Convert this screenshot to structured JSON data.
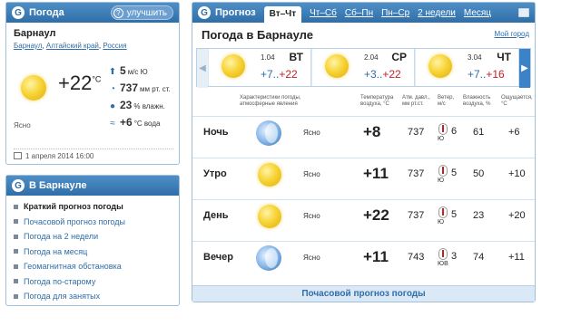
{
  "card": {
    "header_title": "Погода",
    "improve_label": "улучшить",
    "city": "Барнаул",
    "breadcrumbs": [
      "Барнаул",
      "Алтайский край",
      "Россия"
    ],
    "temp": "+22",
    "temp_unit": "°C",
    "condition": "Ясно",
    "wind_value": "5",
    "wind_unit": "м/с  Ю",
    "pressure_value": "737",
    "pressure_unit": "мм рт. ст.",
    "humidity_value": "23",
    "humidity_unit": "% влажн.",
    "water_value": "+6",
    "water_unit": "°C вода",
    "timestamp": "1 апреля 2014 16:00"
  },
  "links": {
    "header_title": "В Барнауле",
    "items": [
      {
        "label": "Краткий прогноз погоды",
        "active": true
      },
      {
        "label": "Почасовой прогноз погоды",
        "active": false
      },
      {
        "label": "Погода на 2 недели",
        "active": false
      },
      {
        "label": "Погода на месяц",
        "active": false
      },
      {
        "label": "Геомагнитная обстановка",
        "active": false
      },
      {
        "label": "Погода по-старому",
        "active": false
      },
      {
        "label": "Погода для занятых",
        "active": false
      }
    ]
  },
  "forecast": {
    "tabs": [
      "Прогноз",
      "Вт–Чт",
      "Чт–Сб",
      "Сб–Пн",
      "Пн–Ср",
      "2 недели",
      "Месяц"
    ],
    "title": "Погода в Барнауле",
    "my_city_link": "Мой город",
    "days": [
      {
        "date": "1.04",
        "weekday": "ВТ",
        "lo": "+7..",
        "hi": "+22"
      },
      {
        "date": "2.04",
        "weekday": "СР",
        "lo": "+3..",
        "hi": "+22"
      },
      {
        "date": "3.04",
        "weekday": "ЧТ",
        "lo": "+7..",
        "hi": "+16"
      }
    ],
    "columns": {
      "condition": "Характеристики погоды,\nатмосферные явления",
      "temp": "Температура\nвоздуха, °С",
      "pressure": "Атм. давл.,\nмм рт.ст.",
      "wind": "Ветер,\nм/с",
      "humidity": "Влажность\nвоздуха, %",
      "feels": "Ощущается,\n°С"
    },
    "rows": [
      {
        "label": "Ночь",
        "condition": "Ясно",
        "temp": "+8",
        "pressure": "737",
        "wind_dir": "Ю",
        "wind_speed": "6",
        "humidity": "61",
        "feels": "+6"
      },
      {
        "label": "Утро",
        "condition": "Ясно",
        "temp": "+11",
        "pressure": "737",
        "wind_dir": "Ю",
        "wind_speed": "5",
        "humidity": "50",
        "feels": "+10"
      },
      {
        "label": "День",
        "condition": "Ясно",
        "temp": "+22",
        "pressure": "737",
        "wind_dir": "Ю",
        "wind_speed": "5",
        "humidity": "23",
        "feels": "+20"
      },
      {
        "label": "Вечер",
        "condition": "Ясно",
        "temp": "+11",
        "pressure": "743",
        "wind_dir": "ЮВ",
        "wind_speed": "3",
        "humidity": "74",
        "feels": "+11"
      }
    ],
    "hourly_link": "Почасовой прогноз погоды"
  }
}
